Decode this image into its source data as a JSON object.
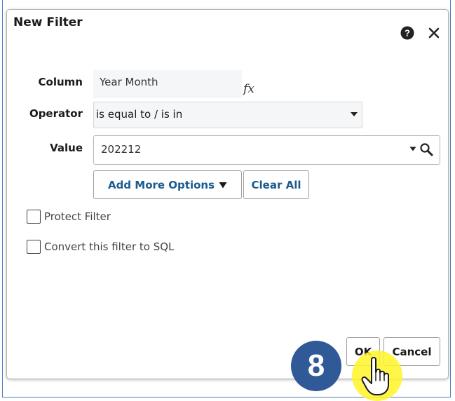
{
  "dialog": {
    "title": "New Filter",
    "help_icon": "help-icon",
    "close_icon": "close-icon"
  },
  "form": {
    "column_label": "Column",
    "column_value": "Year Month",
    "fx_label": "fx",
    "operator_label": "Operator",
    "operator_value": "is equal to / is in",
    "value_label": "Value",
    "value_value": "202212",
    "add_more_options_label": "Add More Options",
    "clear_all_label": "Clear All"
  },
  "checkboxes": {
    "protect_filter": {
      "label": "Protect Filter",
      "checked": false
    },
    "convert_sql": {
      "label": "Convert this filter to SQL",
      "checked": false
    }
  },
  "footer": {
    "ok_label": "OK",
    "cancel_label": "Cancel"
  },
  "annotation": {
    "step_number": "8",
    "badge_color": "#2f5a97",
    "highlight_color": "#fff528",
    "cursor_icon": "hand-pointer-icon"
  },
  "colors": {
    "link_text": "#1b5b8e",
    "frame_border": "#4a7fc1"
  }
}
